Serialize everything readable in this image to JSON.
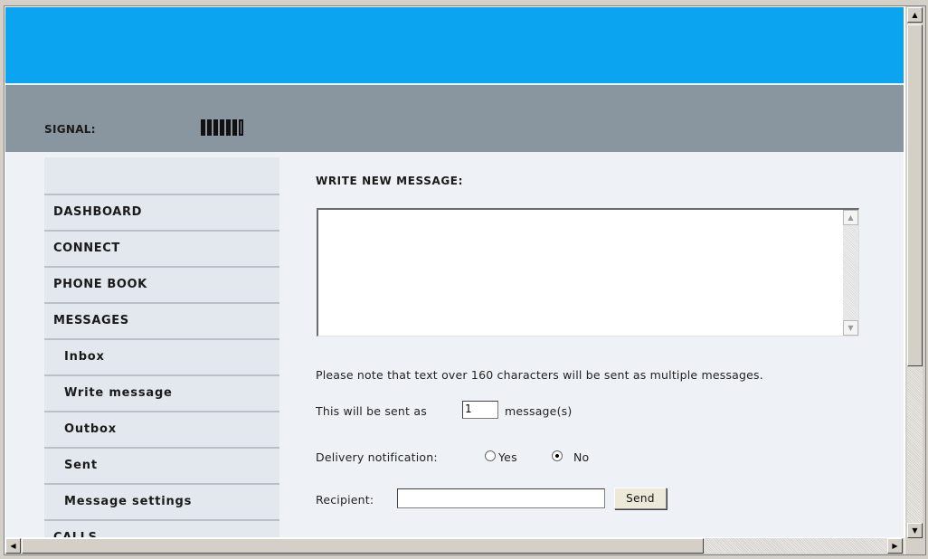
{
  "header": {
    "signal_label": "SIGNAL:",
    "signal_level": 6,
    "signal_max": 7
  },
  "sidebar": {
    "items": [
      {
        "label": "DASHBOARD",
        "level": "top"
      },
      {
        "label": "CONNECT",
        "level": "top"
      },
      {
        "label": "PHONE BOOK",
        "level": "top"
      },
      {
        "label": "MESSAGES",
        "level": "top"
      },
      {
        "label": "Inbox",
        "level": "sub"
      },
      {
        "label": "Write message",
        "level": "sub"
      },
      {
        "label": "Outbox",
        "level": "sub"
      },
      {
        "label": "Sent",
        "level": "sub"
      },
      {
        "label": "Message settings",
        "level": "sub"
      },
      {
        "label": "CALLS",
        "level": "top"
      }
    ]
  },
  "main": {
    "heading": "WRITE NEW MESSAGE:",
    "message_text": "",
    "note": "Please note that text over 160 characters will be sent as multiple messages.",
    "sent_as_prefix": "This will be sent as",
    "sent_as_count": "1",
    "sent_as_suffix": "message(s)",
    "delivery_label": "Delivery notification:",
    "delivery_yes": "Yes",
    "delivery_no": "No",
    "delivery_selected": "No",
    "recipient_label": "Recipient:",
    "recipient_value": "",
    "send_label": "Send"
  },
  "colors": {
    "banner": "#0aa4f0",
    "status_bar": "#8a969f",
    "sidebar": "#e2e8ed",
    "content_bg": "#eef2f6"
  },
  "icons": {
    "scroll_up": "▲",
    "scroll_down": "▼",
    "scroll_left": "◀",
    "scroll_right": "▶"
  }
}
